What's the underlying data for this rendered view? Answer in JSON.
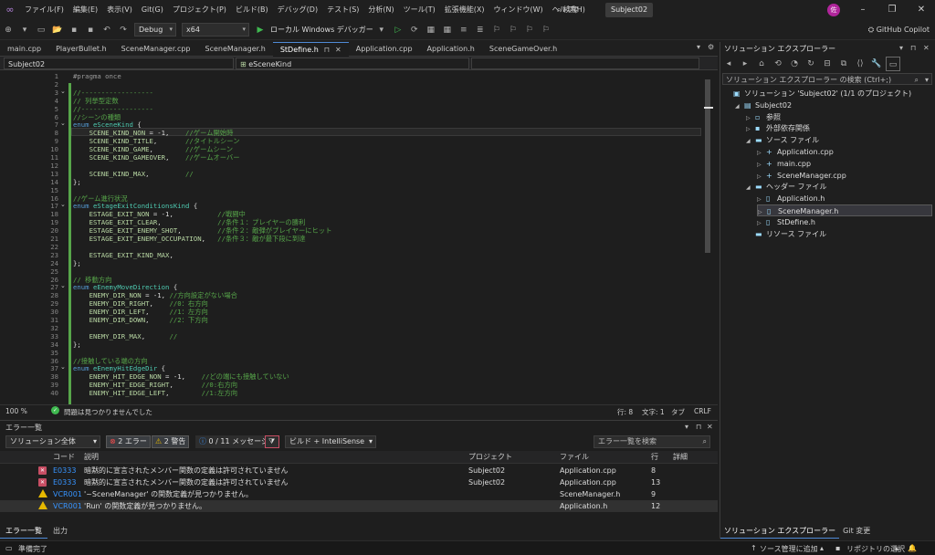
{
  "menu": {
    "items": [
      "ファイル(F)",
      "編集(E)",
      "表示(V)",
      "Git(G)",
      "プロジェクト(P)",
      "ビルド(B)",
      "デバッグ(D)",
      "テスト(S)",
      "分析(N)",
      "ツール(T)",
      "拡張機能(X)",
      "ウィンドウ(W)",
      "ヘルプ(H)"
    ],
    "search_label": "検索",
    "solution_name": "Subject02",
    "avatar_initial": "佐"
  },
  "toolbar": {
    "config": "Debug",
    "platform": "x64",
    "run_label": "ローカル Windows デバッガー",
    "copilot": "GitHub Copilot"
  },
  "doc_tabs": [
    {
      "label": "main.cpp"
    },
    {
      "label": "PlayerBullet.h"
    },
    {
      "label": "SceneManager.cpp"
    },
    {
      "label": "SceneManager.h"
    },
    {
      "label": "StDefine.h",
      "active": true
    },
    {
      "label": "Application.cpp"
    },
    {
      "label": "Application.h"
    },
    {
      "label": "SceneGameOver.h"
    }
  ],
  "navbar": {
    "project": "Subject02",
    "scope": "eSceneKind"
  },
  "code": [
    {
      "n": "1",
      "t": "#pragma once"
    },
    {
      "n": "2",
      "t": ""
    },
    {
      "n": "3",
      "t": "//------------------"
    },
    {
      "n": "4",
      "t": "// 列挙型定数"
    },
    {
      "n": "5",
      "t": "//------------------"
    },
    {
      "n": "6",
      "t": "//シーンの種類"
    },
    {
      "n": "7",
      "t": "enum eSceneKind {"
    },
    {
      "n": "8",
      "t": "    SCENE_KIND_NON = -1,    //ゲーム開始時"
    },
    {
      "n": "9",
      "t": "    SCENE_KIND_TITLE,       //タイトルシーン"
    },
    {
      "n": "10",
      "t": "    SCENE_KIND_GAME,        //ゲームシーン"
    },
    {
      "n": "11",
      "t": "    SCENE_KIND_GAMEOVER,    //ゲームオーバー"
    },
    {
      "n": "12",
      "t": ""
    },
    {
      "n": "13",
      "t": "    SCENE_KIND_MAX,         //"
    },
    {
      "n": "14",
      "t": "};"
    },
    {
      "n": "15",
      "t": ""
    },
    {
      "n": "16",
      "t": "//ゲーム進行状況"
    },
    {
      "n": "17",
      "t": "enum eStageExitConditionsKind {"
    },
    {
      "n": "18",
      "t": "    ESTAGE_EXIT_NON = -1,           //戦闘中"
    },
    {
      "n": "19",
      "t": "    ESTAGE_EXIT_CLEAR,              //条件１：プレイヤーの勝利"
    },
    {
      "n": "20",
      "t": "    ESTAGE_EXIT_ENEMY_SHOT,         //条件２：敵弾がプレイヤーにヒット"
    },
    {
      "n": "21",
      "t": "    ESTAGE_EXIT_ENEMY_OCCUPATION,   //条件３：敵が最下段に到達"
    },
    {
      "n": "22",
      "t": ""
    },
    {
      "n": "23",
      "t": "    ESTAGE_EXIT_KIND_MAX,"
    },
    {
      "n": "24",
      "t": "};"
    },
    {
      "n": "25",
      "t": ""
    },
    {
      "n": "26",
      "t": "// 移動方向"
    },
    {
      "n": "27",
      "t": "enum eEnemyMoveDirection {"
    },
    {
      "n": "28",
      "t": "    ENEMY_DIR_NON = -1, //方向設定がない場合"
    },
    {
      "n": "29",
      "t": "    ENEMY_DIR_RIGHT,    //0：右方向"
    },
    {
      "n": "30",
      "t": "    ENEMY_DIR_LEFT,     //1：左方向"
    },
    {
      "n": "31",
      "t": "    ENEMY_DIR_DOWN,     //2：下方向"
    },
    {
      "n": "32",
      "t": ""
    },
    {
      "n": "33",
      "t": "    ENEMY_DIR_MAX,      //"
    },
    {
      "n": "34",
      "t": "};"
    },
    {
      "n": "35",
      "t": ""
    },
    {
      "n": "36",
      "t": "//接触している端の方向"
    },
    {
      "n": "37",
      "t": "enum eEnemyHitEdgeDir {"
    },
    {
      "n": "38",
      "t": "    ENEMY_HIT_EDGE_NON = -1,    //どの端にも接触していない"
    },
    {
      "n": "39",
      "t": "    ENEMY_HIT_EDGE_RIGHT,       //0:右方向"
    },
    {
      "n": "40",
      "t": "    ENEMY_HIT_EDGE_LEFT,        //1:左方向"
    }
  ],
  "editor_status": {
    "zoom": "100 %",
    "issues": "問題は見つかりませんでした",
    "line": "行: 8",
    "col": "文字: 1",
    "tab": "タブ",
    "eol": "CRLF"
  },
  "error_list": {
    "title": "エラー一覧",
    "scope": "ソリューション全体",
    "errors_btn": "2 エラー",
    "warnings_btn": "2 警告",
    "messages_btn": "0 / 11 メッセージ",
    "build_filter": "ビルド + IntelliSense",
    "search_placeholder": "エラー一覧を検索",
    "columns": {
      "code": "コード",
      "desc": "説明",
      "project": "プロジェクト",
      "file": "ファイル",
      "line": "行",
      "detail": "詳細"
    },
    "rows": [
      {
        "kind": "error",
        "code": "E0333",
        "desc": "暗黙的に宣言されたメンバー関数の定義は許可されていません",
        "project": "Subject02",
        "file": "Application.cpp",
        "line": "8"
      },
      {
        "kind": "error",
        "code": "E0333",
        "desc": "暗黙的に宣言されたメンバー関数の定義は許可されていません",
        "project": "Subject02",
        "file": "Application.cpp",
        "line": "13"
      },
      {
        "kind": "warning",
        "code": "VCR001",
        "desc": "'~SceneManager' の関数定義が見つかりません。",
        "project": "",
        "file": "SceneManager.h",
        "line": "9"
      },
      {
        "kind": "warning",
        "code": "VCR001",
        "desc": "'Run' の関数定義が見つかりません。",
        "project": "",
        "file": "Application.h",
        "line": "12"
      }
    ],
    "tabs": [
      "エラー一覧",
      "出力"
    ]
  },
  "solution_explorer": {
    "title": "ソリューション エクスプローラー",
    "search_placeholder": "ソリューション エクスプローラー の検索 (Ctrl+;)",
    "items": [
      {
        "label": "ソリューション 'Subject02' (1/1 のプロジェクト)",
        "indent": 0,
        "twisty": "",
        "icon": "▣"
      },
      {
        "label": "Subject02",
        "indent": 1,
        "twisty": "◢",
        "icon": "▤"
      },
      {
        "label": "参照",
        "indent": 2,
        "twisty": "▷",
        "icon": "▫"
      },
      {
        "label": "外部依存関係",
        "indent": 2,
        "twisty": "▷",
        "icon": "▪"
      },
      {
        "label": "ソース ファイル",
        "indent": 2,
        "twisty": "◢",
        "icon": "▬"
      },
      {
        "label": "Application.cpp",
        "indent": 3,
        "twisty": "▷",
        "icon": "+"
      },
      {
        "label": "main.cpp",
        "indent": 3,
        "twisty": "▷",
        "icon": "+"
      },
      {
        "label": "SceneManager.cpp",
        "indent": 3,
        "twisty": "▷",
        "icon": "+"
      },
      {
        "label": "ヘッダー ファイル",
        "indent": 2,
        "twisty": "◢",
        "icon": "▬"
      },
      {
        "label": "Application.h",
        "indent": 3,
        "twisty": "▷",
        "icon": "▯"
      },
      {
        "label": "SceneManager.h",
        "indent": 3,
        "twisty": "▷",
        "icon": "▯",
        "selected": true
      },
      {
        "label": "StDefine.h",
        "indent": 3,
        "twisty": "▷",
        "icon": "▯"
      },
      {
        "label": "リソース ファイル",
        "indent": 2,
        "twisty": "",
        "icon": "▬"
      }
    ],
    "tabs": [
      "ソリューション エクスプローラー",
      "Git 変更"
    ]
  },
  "statusbar": {
    "ready": "準備完了",
    "source_control": "ソース管理に追加",
    "repository": "リポジトリの選択"
  }
}
